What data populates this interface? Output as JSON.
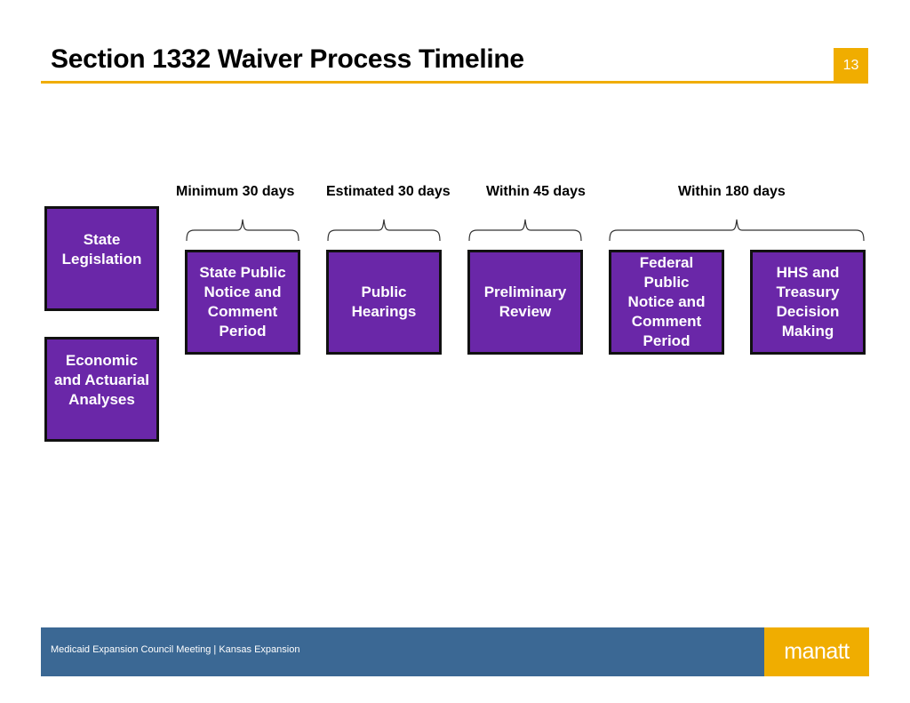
{
  "slide": {
    "title": "Section 1332 Waiver Process Timeline",
    "page_number": "13"
  },
  "timeline": {
    "durations": [
      {
        "label": "Minimum 30 days"
      },
      {
        "label": "Estimated 30 days"
      },
      {
        "label": "Within 45 days"
      },
      {
        "label": "Within 180 days"
      }
    ],
    "prerequisites": [
      {
        "label": "State\nLegislation"
      },
      {
        "label": "Economic\nand Actuarial\nAnalyses"
      }
    ],
    "steps": [
      {
        "label": "State Public\nNotice and\nComment\nPeriod"
      },
      {
        "label": "Public\nHearings"
      },
      {
        "label": "Preliminary\nReview"
      },
      {
        "label": "Federal\nPublic\nNotice and\nComment\nPeriod"
      },
      {
        "label": "HHS and\nTreasury\nDecision\nMaking"
      }
    ],
    "colors": {
      "box_fill": "#6a27a8",
      "accent": "#f0ad00",
      "footer": "#3b6894"
    }
  },
  "footer": {
    "text": "Medicaid Expansion Council Meeting | Kansas Expansion",
    "logo": "manatt"
  }
}
